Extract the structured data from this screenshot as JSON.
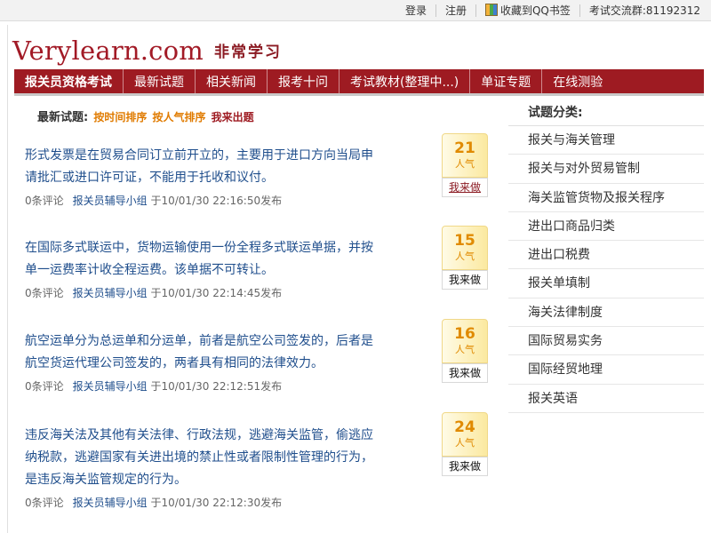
{
  "topbar": {
    "login": "登录",
    "register": "注册",
    "bookmark": "收藏到QQ书签",
    "group": "考试交流群:81192312"
  },
  "logo": {
    "en": "Verylearn.com",
    "cn": "非常学习"
  },
  "nav": {
    "tabs": [
      "报关员资格考试",
      "最新试题",
      "相关新闻",
      "报考十问",
      "考试教材(整理中...)",
      "单证专题",
      "在线测验"
    ]
  },
  "sort": {
    "label": "最新试题:",
    "by_time": "按时间排序",
    "by_pop": "按人气排序",
    "mine": "我来出题"
  },
  "questions": [
    {
      "text": "形式发票是在贸易合同订立前开立的，主要用于进口方向当局申请批汇或进口许可证，不能用于托收和议付。",
      "comments": "0条评论",
      "author": "报关员辅导小组",
      "time": "于10/01/30 22:16:50发布",
      "popularity": "21",
      "pop_label": "人气",
      "action": "我来做"
    },
    {
      "text": "在国际多式联运中，货物运输使用一份全程多式联运单据，并按单一运费率计收全程运费。该单据不可转让。",
      "comments": "0条评论",
      "author": "报关员辅导小组",
      "time": "于10/01/30 22:14:45发布",
      "popularity": "15",
      "pop_label": "人气",
      "action": "我来做"
    },
    {
      "text": "航空运单分为总运单和分运单，前者是航空公司签发的，后者是航空货运代理公司签发的，两者具有相同的法律效力。",
      "comments": "0条评论",
      "author": "报关员辅导小组",
      "time": "于10/01/30 22:12:51发布",
      "popularity": "16",
      "pop_label": "人气",
      "action": "我来做"
    },
    {
      "text": "违反海关法及其他有关法律、行政法规，逃避海关监管，偷逃应纳税款，逃避国家有关进出境的禁止性或者限制性管理的行为，是违反海关监管规定的行为。",
      "comments": "0条评论",
      "author": "报关员辅导小组",
      "time": "于10/01/30 22:12:30发布",
      "popularity": "24",
      "pop_label": "人气",
      "action": "我来做"
    }
  ],
  "sidebar": {
    "title": "试题分类:",
    "categories": [
      "报关与海关管理",
      "报关与对外贸易管制",
      "海关监管货物及报关程序",
      "进出口商品归类",
      "进出口税费",
      "报关单填制",
      "海关法律制度",
      "国际贸易实务",
      "国际经贸地理",
      "报关英语"
    ]
  }
}
